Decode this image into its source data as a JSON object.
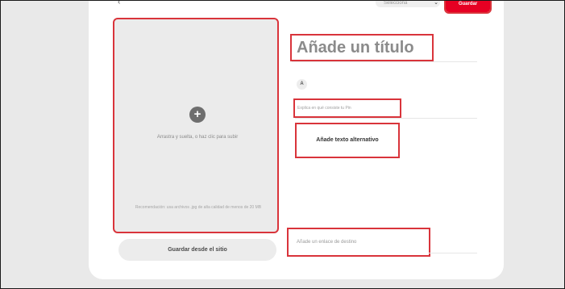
{
  "topbar": {
    "back_icon": "chevron-left-icon",
    "board_select_value": "Selecciona",
    "save_label": "Guardar"
  },
  "upload": {
    "icon": "plus-circle-icon",
    "instruction": "Arrastra y suelta, o haz clic para subir",
    "recommendation": "Recomendación: usa archivos .jpg de alta calidad de menos de 20 MB",
    "save_from_site_label": "Guardar desde el sitio"
  },
  "form": {
    "title_placeholder": "Añade un título",
    "avatar_initial": "A",
    "description_placeholder": "Explica en qué consiste tu Pin",
    "alt_text_label": "Añade texto alternativo",
    "destination_placeholder": "Añade un enlace de destino"
  },
  "colors": {
    "highlight": "#d9343b",
    "brand_red": "#e60023",
    "background": "#e9e9e9",
    "card": "#ffffff"
  }
}
